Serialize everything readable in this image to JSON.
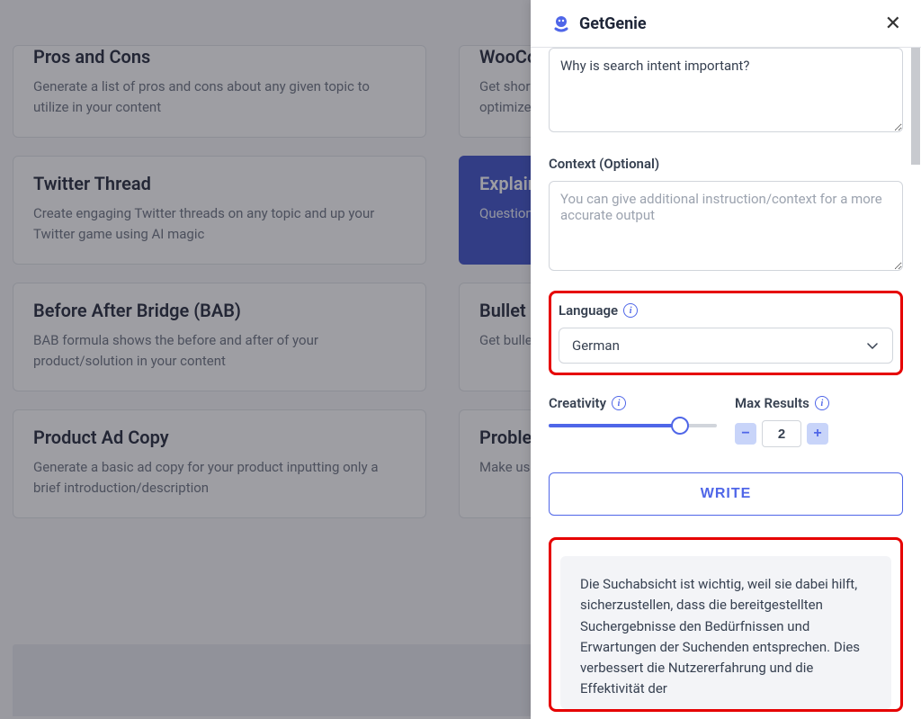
{
  "cards": {
    "row1": [
      {
        "title": "Pros and Cons",
        "desc": "Generate a list of pros and cons about any given topic to utilize in your content"
      },
      {
        "title": "WooCommerce Short Description",
        "desc": "Get short descriptions for your WooCommerce products optimized for conversions"
      }
    ],
    "row2": [
      {
        "title": "Twitter Thread",
        "desc": "Create engaging Twitter threads on any topic and up your Twitter game using AI magic"
      },
      {
        "title": "Explain",
        "desc": "Questions need explanations — let's explore them"
      }
    ],
    "row3": [
      {
        "title": "Before After Bridge (BAB)",
        "desc": "BAB formula shows the before and after of your product/solution in your content"
      },
      {
        "title": "Bullet Points",
        "desc": "Get bulleted summaries instead of writing long form content"
      }
    ],
    "row4": [
      {
        "title": "Product Ad Copy",
        "desc": "Generate a basic ad copy for your product inputting only a brief introduction/description"
      },
      {
        "title": "Problem Agitate Solve",
        "desc": "Make use of the Problem, Agitate, Solve framework"
      }
    ]
  },
  "panel": {
    "brand": "GetGenie",
    "topic": {
      "value": "Why is search intent important?"
    },
    "context": {
      "label": "Context (Optional)",
      "placeholder": "You can give additional instruction/context for a more accurate output",
      "value": ""
    },
    "language": {
      "label": "Language",
      "selected": "German"
    },
    "creativity": {
      "label": "Creativity",
      "value": 4
    },
    "maxResults": {
      "label": "Max Results",
      "value": "2"
    },
    "writeButton": "WRITE",
    "result": "Die Suchabsicht ist wichtig, weil sie dabei hilft, sicherzustellen, dass die bereitgestellten Suchergebnisse den Bedürfnissen und Erwartungen der Suchenden entsprechen. Dies verbessert die Nutzererfahrung und die Effektivität der"
  }
}
